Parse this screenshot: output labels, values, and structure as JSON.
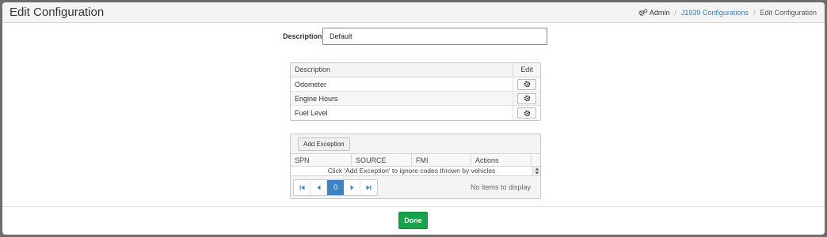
{
  "header": {
    "title": "Edit Configuration",
    "breadcrumb": {
      "admin": "Admin",
      "j1939": "J1939 Configurations",
      "current": "Edit Configuration"
    }
  },
  "form": {
    "description_label": "Description",
    "description_value": "Default"
  },
  "properties_grid": {
    "columns": [
      "Description",
      "Edit"
    ],
    "rows": [
      {
        "label": "Odometer"
      },
      {
        "label": "Engine Hours"
      },
      {
        "label": "Fuel Level"
      }
    ]
  },
  "exceptions_grid": {
    "add_button": "Add Exception",
    "columns": [
      "SPN",
      "SOURCE",
      "FMI",
      "Actions"
    ],
    "empty_message": "Click 'Add Exception' to ignore codes thrown by vehicles",
    "pager": {
      "current_page": "0",
      "status": "No items to display"
    }
  },
  "footer": {
    "done_label": "Done"
  },
  "colors": {
    "accent_blue": "#3c83c6",
    "done_green": "#18a24b",
    "link": "#3c7fb6"
  }
}
